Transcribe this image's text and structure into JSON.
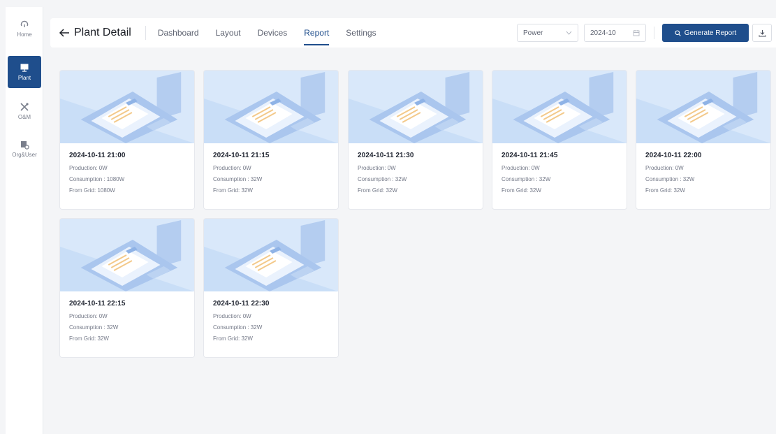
{
  "rail": {
    "items": [
      {
        "label": "Home",
        "icon": "home-icon"
      },
      {
        "label": "Plant",
        "icon": "solar-panel-icon"
      },
      {
        "label": "O&M",
        "icon": "tools-icon"
      },
      {
        "label": "Org&User",
        "icon": "org-user-icon"
      }
    ],
    "active": "Plant"
  },
  "header": {
    "title": "Plant Detail",
    "tabs": [
      "Dashboard",
      "Layout",
      "Devices",
      "Report",
      "Settings"
    ],
    "active_tab": "Report",
    "metric_select": "Power",
    "date_value": "2024-10",
    "generate_label": "Generate Report"
  },
  "colors": {
    "accent": "#1f4e8c",
    "background": "#f4f5f7",
    "card": "#ffffff"
  },
  "reports": [
    {
      "title": "2024-10-11 21:00",
      "production": "Production: 0W",
      "consumption": "Consumption : 1080W",
      "from_grid": "From Grid: 1080W"
    },
    {
      "title": "2024-10-11 21:15",
      "production": "Production: 0W",
      "consumption": "Consumption : 32W",
      "from_grid": "From Grid: 32W"
    },
    {
      "title": "2024-10-11 21:30",
      "production": "Production: 0W",
      "consumption": "Consumption : 32W",
      "from_grid": "From Grid: 32W"
    },
    {
      "title": "2024-10-11 21:45",
      "production": "Production: 0W",
      "consumption": "Consumption : 32W",
      "from_grid": "From Grid: 32W"
    },
    {
      "title": "2024-10-11 22:00",
      "production": "Production: 0W",
      "consumption": "Consumption : 32W",
      "from_grid": "From Grid: 32W"
    },
    {
      "title": "2024-10-11 22:15",
      "production": "Production: 0W",
      "consumption": "Consumption : 32W",
      "from_grid": "From Grid: 32W"
    },
    {
      "title": "2024-10-11 22:30",
      "production": "Production: 0W",
      "consumption": "Consumption : 32W",
      "from_grid": "From Grid: 32W"
    }
  ]
}
